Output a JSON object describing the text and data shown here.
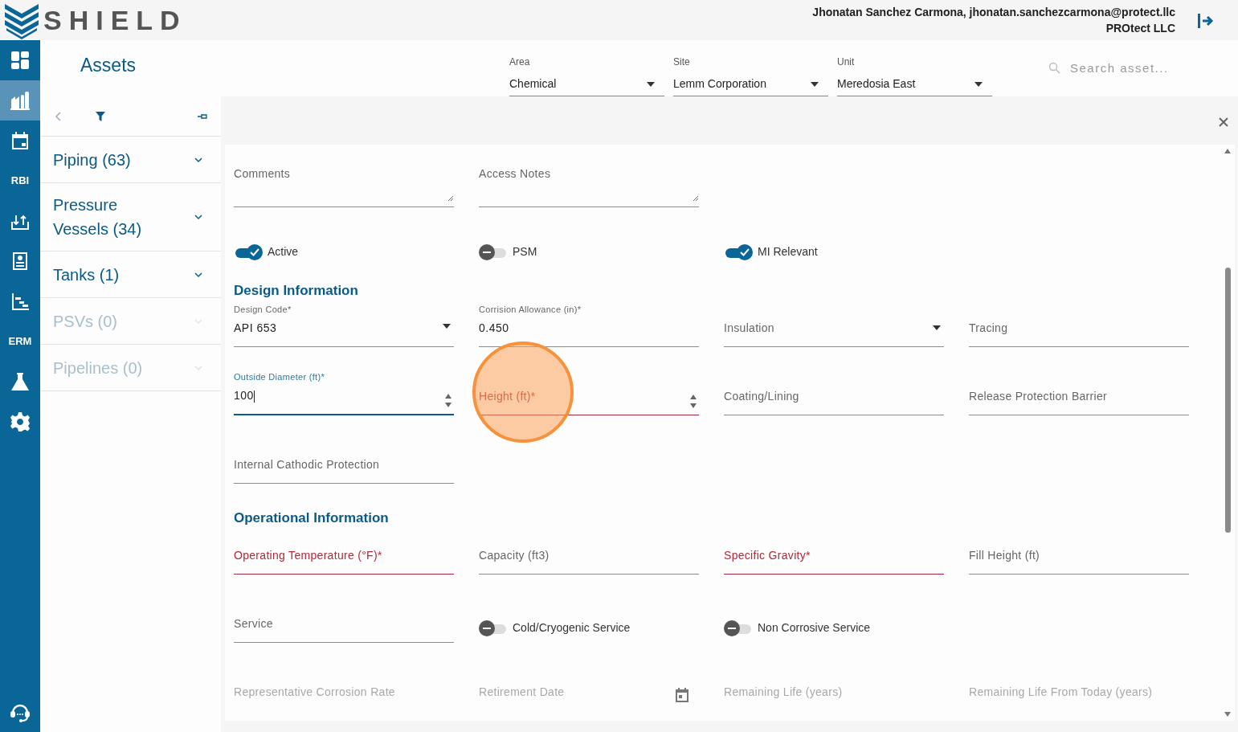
{
  "brand": {
    "logo_text": "SHIELD"
  },
  "user": {
    "name_line": "Jhonatan Sanchez Carmona, jhonatan.sanchezcarmona@protect.llc",
    "company": "PROtect LLC"
  },
  "rail": [
    {
      "kind": "grid",
      "selected": false
    },
    {
      "kind": "plant",
      "selected": true
    },
    {
      "kind": "calendar",
      "selected": false
    },
    {
      "kind": "label",
      "label": "RBI",
      "selected": false
    },
    {
      "kind": "upload",
      "selected": false
    },
    {
      "kind": "report",
      "selected": false
    },
    {
      "kind": "chart",
      "selected": false
    },
    {
      "kind": "label",
      "label": "ERM",
      "selected": false
    },
    {
      "kind": "flask",
      "selected": false
    },
    {
      "kind": "gear",
      "selected": false
    },
    {
      "kind": "headset",
      "selected": false
    }
  ],
  "sidebar": {
    "title": "Assets",
    "items": [
      {
        "label": "Piping (63)",
        "disabled": false
      },
      {
        "label": "Pressure Vessels (34)",
        "disabled": false
      },
      {
        "label": "Tanks (1)",
        "disabled": false
      },
      {
        "label": "PSVs (0)",
        "disabled": true
      },
      {
        "label": "Pipelines (0)",
        "disabled": true
      }
    ]
  },
  "filters": [
    {
      "label": "Area",
      "value": "Chemical"
    },
    {
      "label": "Site",
      "value": "Lemm Corporation"
    },
    {
      "label": "Unit",
      "value": "Meredosia East"
    }
  ],
  "search": {
    "placeholder": "Search asset..."
  },
  "form_rows": [
    [
      {
        "kind": "textarea",
        "label": "Comments"
      },
      {
        "kind": "textarea",
        "label": "Access Notes"
      }
    ],
    [
      {
        "kind": "toggle",
        "label": "Active",
        "on": true
      },
      {
        "kind": "toggle",
        "label": "PSM",
        "on": false
      },
      {
        "kind": "toggle",
        "label": "MI Relevant",
        "on": true
      }
    ],
    [
      {
        "kind": "heading",
        "label": "Design Information"
      }
    ],
    [
      {
        "kind": "select",
        "label": "Design Code*",
        "value": "API 653"
      },
      {
        "kind": "text",
        "label": "Corrision Allowance (in)*",
        "value": "0.450"
      },
      {
        "kind": "select",
        "label": "Insulation"
      },
      {
        "kind": "text",
        "label": "Tracing"
      }
    ],
    [
      {
        "kind": "number",
        "label": "Outside Diameter (ft)*",
        "value": "100",
        "focused": true
      },
      {
        "kind": "number",
        "label": "Height (ft)*",
        "error": true,
        "highlighted": true
      },
      {
        "kind": "text",
        "label": "Coating/Lining"
      },
      {
        "kind": "text",
        "label": "Release Protection Barrier"
      }
    ],
    [
      {
        "kind": "text",
        "label": "Internal Cathodic Protection"
      }
    ],
    [
      {
        "kind": "heading",
        "label": "Operational Information"
      }
    ],
    [
      {
        "kind": "text",
        "label": "Operating Temperature (°F)*",
        "error": true
      },
      {
        "kind": "text",
        "label": "Capacity (ft3)"
      },
      {
        "kind": "text",
        "label": "Specific Gravity*",
        "error": true
      },
      {
        "kind": "text",
        "label": "Fill Height (ft)"
      }
    ],
    [
      {
        "kind": "text",
        "label": "Service"
      },
      {
        "kind": "toggle",
        "label": "Cold/Cryogenic Service",
        "on": false
      },
      {
        "kind": "toggle",
        "label": "Non Corrosive Service",
        "on": false
      }
    ],
    [
      {
        "kind": "text",
        "label": "Representative Corrosion Rate",
        "disabled": true
      },
      {
        "kind": "date",
        "label": "Retirement Date",
        "disabled": true
      },
      {
        "kind": "text",
        "label": "Remaining Life (years)",
        "disabled": true
      },
      {
        "kind": "text",
        "label": "Remaining Life From Today (years)",
        "disabled": true
      }
    ]
  ]
}
